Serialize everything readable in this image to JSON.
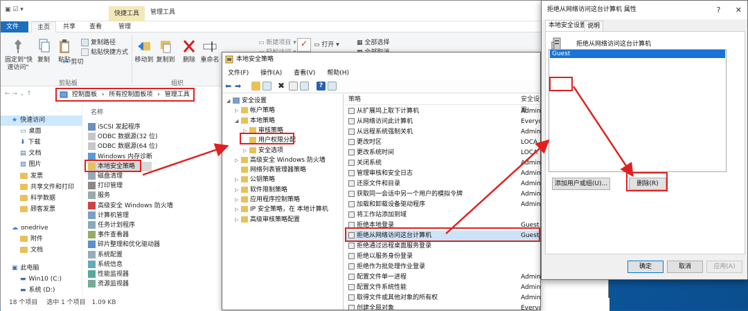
{
  "explorer": {
    "ctx_tab": "快捷工具",
    "title": "管理工具",
    "tabs": [
      "文件",
      "主页",
      "共享",
      "查看",
      "管理"
    ],
    "ribbon": {
      "pin": "固定到\"快\n速访问\"",
      "copy": "复制",
      "paste": "粘贴",
      "copy_path": "复制路径",
      "paste_shortcut": "粘贴快捷方式",
      "cut": "剪切",
      "clipboard_group": "剪贴板",
      "move_to": "移动到",
      "copy_to": "复制到",
      "delete": "删除",
      "rename": "重命名",
      "organize_group": "组织"
    },
    "breadcrumb": [
      "控制面板",
      "所有控制面板项",
      "管理工具"
    ],
    "nav_items": [
      {
        "label": "快速访问",
        "type": "star"
      },
      {
        "label": "桌面",
        "type": "desk"
      },
      {
        "label": "下载",
        "type": "down"
      },
      {
        "label": "文档",
        "type": "doc"
      },
      {
        "label": "图片",
        "type": "pic"
      },
      {
        "label": "发票",
        "type": "folder"
      },
      {
        "label": "共享文件和打印",
        "type": "folder"
      },
      {
        "label": "科学数据",
        "type": "folder"
      },
      {
        "label": "顾客发票",
        "type": "folder"
      },
      {
        "label": "onedrive",
        "type": "cloud"
      },
      {
        "label": "附件",
        "type": "folder"
      },
      {
        "label": "文档",
        "type": "folder"
      },
      {
        "label": "此电脑",
        "type": "pc"
      },
      {
        "label": "Win10 (C:)",
        "type": "drive"
      },
      {
        "label": "系统 (D:)",
        "type": "drive"
      }
    ],
    "name_header": "名称",
    "files": [
      "iSCSI 发起程序",
      "ODBC 数据源(32 位)",
      "ODBC 数据源(64 位)",
      "Windows 内存诊断",
      "本地安全策略",
      "磁盘清理",
      "打印管理",
      "服务",
      "高级安全 Windows 防火墙",
      "计算机管理",
      "任务计划程序",
      "事件查看器",
      "碎片整理和优化驱动器",
      "系统配置",
      "系统信息",
      "性能监视器",
      "资源监视器"
    ],
    "status": {
      "count": "18 个项目",
      "selected": "选中 1 个项目",
      "size": "1.09 KB"
    }
  },
  "secpol": {
    "title": "本地安全策略",
    "menu": [
      "文件(F)",
      "操作(A)",
      "查看(V)",
      "帮助(H)"
    ],
    "tree": [
      {
        "label": "安全设置",
        "indent": 0,
        "arrow": "◢"
      },
      {
        "label": "帐户策略",
        "indent": 1,
        "arrow": "▷"
      },
      {
        "label": "本地策略",
        "indent": 1,
        "arrow": "◢"
      },
      {
        "label": "审核策略",
        "indent": 2,
        "arrow": "▷"
      },
      {
        "label": "用户权限分配",
        "indent": 2,
        "arrow": ""
      },
      {
        "label": "安全选项",
        "indent": 2,
        "arrow": "▷"
      },
      {
        "label": "高级安全 Windows 防火墙",
        "indent": 1,
        "arrow": "▷"
      },
      {
        "label": "网络列表管理器策略",
        "indent": 1,
        "arrow": ""
      },
      {
        "label": "公钥策略",
        "indent": 1,
        "arrow": "▷"
      },
      {
        "label": "软件限制策略",
        "indent": 1,
        "arrow": "▷"
      },
      {
        "label": "应用程序控制策略",
        "indent": 1,
        "arrow": "▷"
      },
      {
        "label": "IP 安全策略，在 本地计算机",
        "indent": 1,
        "arrow": "▷"
      },
      {
        "label": "高级审核策略配置",
        "indent": 1,
        "arrow": "▷"
      }
    ],
    "col_policy": "策略",
    "col_setting": "安全设置",
    "rows": [
      {
        "p": "从扩展坞上取下计算机",
        "v": "Admini"
      },
      {
        "p": "从网络访问此计算机",
        "v": "Everyo"
      },
      {
        "p": "从远程系统强制关机",
        "v": "Admini"
      },
      {
        "p": "更改时区",
        "v": "LOCA"
      },
      {
        "p": "更改系统时间",
        "v": "LOCA"
      },
      {
        "p": "关闭系统",
        "v": "Admini"
      },
      {
        "p": "管理审核和安全日志",
        "v": "Admini"
      },
      {
        "p": "还原文件和目录",
        "v": "Admini"
      },
      {
        "p": "获取同一会话中另一个用户的模拟令牌",
        "v": "Admini"
      },
      {
        "p": "加载和卸载设备驱动程序",
        "v": "Admini"
      },
      {
        "p": "将工作站添加到域",
        "v": ""
      },
      {
        "p": "拒绝本地登录",
        "v": "Guest"
      },
      {
        "p": "拒绝从网络访问这台计算机",
        "v": "Guest"
      },
      {
        "p": "拒绝通过远程桌面服务登录",
        "v": ""
      },
      {
        "p": "拒绝以服务身份登录",
        "v": ""
      },
      {
        "p": "拒绝作为批处理作业登录",
        "v": ""
      },
      {
        "p": "配置文件单一进程",
        "v": "Administrators"
      },
      {
        "p": "配置文件系统性能",
        "v": "Administrators,NT SE..."
      },
      {
        "p": "取得文件或其他对象的所有权",
        "v": "Administrators"
      },
      {
        "p": "创建全局对象",
        "v": "Everyone,LOCAL SERV..."
      }
    ]
  },
  "props": {
    "title": "拒绝从网络访问这台计算机 属性",
    "tabs": [
      "本地安全设置",
      "说明"
    ],
    "policy_name": "拒绝从网络访问这台计算机",
    "user": "Guest",
    "add_button": "添加用户或组(U)...",
    "remove_button": "删除(R)",
    "ok": "确定",
    "cancel": "取消",
    "apply": "应用(A)"
  },
  "colors": {
    "annotation": "#e02020",
    "accent": "#1a73d6",
    "desktop": "#1f8fd6"
  }
}
